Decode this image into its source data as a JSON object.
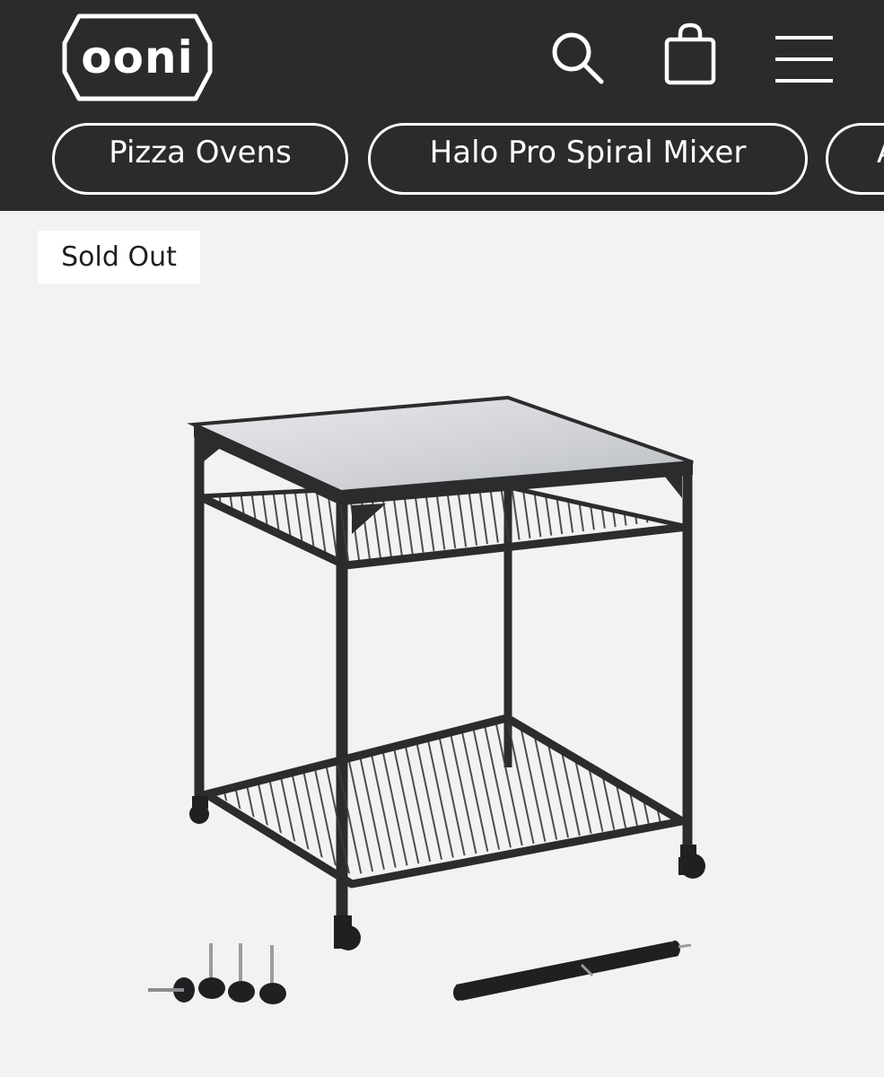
{
  "header": {
    "logo_text": "ooni",
    "icons": [
      "search-icon",
      "shopping-bag-icon",
      "hamburger-menu-icon"
    ]
  },
  "categories": [
    {
      "label": "Pizza Ovens"
    },
    {
      "label": "Halo Pro Spiral Mixer"
    },
    {
      "label": "A"
    }
  ],
  "product": {
    "badge": "Sold Out"
  },
  "colors": {
    "header_bg": "#2a2b2d",
    "page_bg": "#f2f2f2",
    "badge_bg": "#ffffff",
    "frame": "#2b2c2e"
  }
}
